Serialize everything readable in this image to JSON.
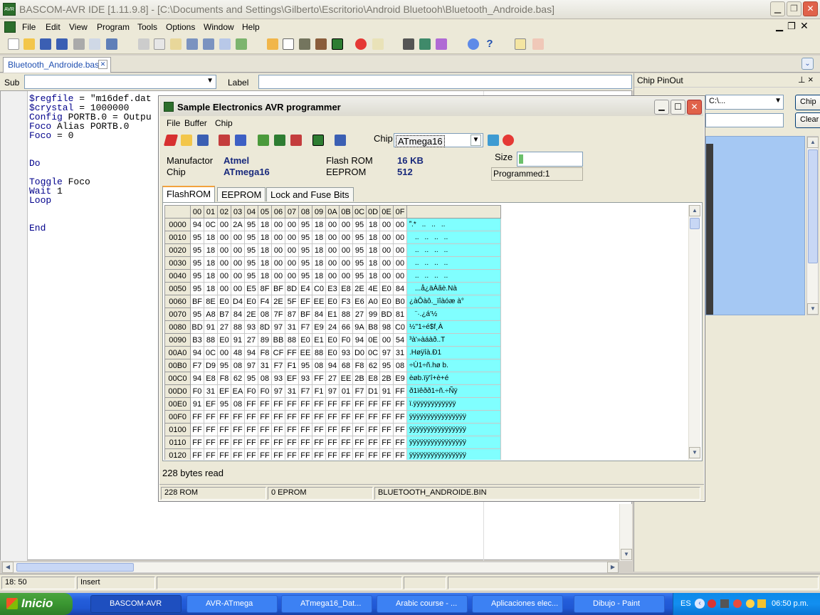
{
  "window": {
    "title": "BASCOM-AVR IDE [1.11.9.8] - [C:\\Documents and Settings\\Gilberto\\Escritorio\\Android Bluetooh\\Bluetooth_Androide.bas]",
    "icon_text": "AVR"
  },
  "menu": [
    "File",
    "Edit",
    "View",
    "Program",
    "Tools",
    "Options",
    "Window",
    "Help"
  ],
  "doc_tab": "Bluetooth_Androide.bas",
  "subbar": {
    "sub_label": "Sub",
    "label_label": "Label"
  },
  "code_lines": [
    {
      "kw": "$regfile",
      "rest": " = \"m16def.dat"
    },
    {
      "kw": "$crystal",
      "rest": " = 1000000"
    },
    {
      "kw": "Config",
      "rest": " PORTB.0 = Outpu"
    },
    {
      "kw": "Foco",
      "rest": " Alias PORTB.0"
    },
    {
      "kw": "Foco",
      "rest": " = 0"
    },
    {
      "kw": "",
      "rest": ""
    },
    {
      "kw": "",
      "rest": ""
    },
    {
      "kw": "Do",
      "rest": ""
    },
    {
      "kw": "",
      "rest": ""
    },
    {
      "kw": "Toggle",
      "rest": " Foco"
    },
    {
      "kw": "Wait",
      "rest": " 1"
    },
    {
      "kw": "Loop",
      "rest": ""
    },
    {
      "kw": "",
      "rest": ""
    },
    {
      "kw": "",
      "rest": ""
    },
    {
      "kw": "End",
      "rest": ""
    }
  ],
  "pinout": {
    "title": "Chip PinOut",
    "path": "C:\\...",
    "chip_button": "Chip",
    "clear_button": "Clear"
  },
  "programmer": {
    "title": "Sample Electronics AVR programmer",
    "menu": [
      "File",
      "Buffer",
      "Chip"
    ],
    "chip_label": "Chip",
    "chip_value": "ATmega16",
    "manufacturer_label": "Manufactor",
    "manufacturer": "Atmel",
    "chip_info_label": "Chip",
    "chip_info": "ATmega16",
    "flash_label": "Flash ROM",
    "flash": "16 KB",
    "eeprom_label": "EEPROM",
    "eeprom": "512",
    "size_label": "Size",
    "programmed": "Programmed:1",
    "tabs": [
      "FlashROM",
      "EEPROM",
      "Lock and Fuse Bits"
    ],
    "bytes_read": "228 bytes read",
    "status": [
      "228 ROM",
      "0 EPROM",
      "BLUETOOTH_ANDROIDE.BIN"
    ],
    "hex_header": [
      "00",
      "01",
      "02",
      "03",
      "04",
      "05",
      "06",
      "07",
      "08",
      "09",
      "0A",
      "0B",
      "0C",
      "0D",
      "0E",
      "0F"
    ],
    "hex_rows": [
      {
        "addr": "0000",
        "bytes": [
          "94",
          "0C",
          "00",
          "2A",
          "95",
          "18",
          "00",
          "00",
          "95",
          "18",
          "00",
          "00",
          "95",
          "18",
          "00",
          "00"
        ],
        "ascii": ".*......"
      },
      {
        "addr": "0010",
        "bytes": [
          "95",
          "18",
          "00",
          "00",
          "95",
          "18",
          "00",
          "00",
          "95",
          "18",
          "00",
          "00",
          "95",
          "18",
          "00",
          "00"
        ],
        "ascii": "........"
      },
      {
        "addr": "0020",
        "bytes": [
          "95",
          "18",
          "00",
          "00",
          "95",
          "18",
          "00",
          "00",
          "95",
          "18",
          "00",
          "00",
          "95",
          "18",
          "00",
          "00"
        ],
        "ascii": "........"
      },
      {
        "addr": "0030",
        "bytes": [
          "95",
          "18",
          "00",
          "00",
          "95",
          "18",
          "00",
          "00",
          "95",
          "18",
          "00",
          "00",
          "95",
          "18",
          "00",
          "00"
        ],
        "ascii": "........"
      },
      {
        "addr": "0040",
        "bytes": [
          "95",
          "18",
          "00",
          "00",
          "95",
          "18",
          "00",
          "00",
          "95",
          "18",
          "00",
          "00",
          "95",
          "18",
          "00",
          "00"
        ],
        "ascii": "........"
      },
      {
        "addr": "0050",
        "bytes": [
          "95",
          "18",
          "00",
          "00",
          "E5",
          "8F",
          "BF",
          "8D",
          "E4",
          "C0",
          "E3",
          "E8",
          "2E",
          "4E",
          "E0",
          "84"
        ],
        "ascii": "...å¿äÀãè.Nà"
      },
      {
        "addr": "0060",
        "bytes": [
          "BF",
          "8E",
          "E0",
          "D4",
          "E0",
          "F4",
          "2E",
          "5F",
          "EF",
          "EE",
          "E0",
          "F3",
          "E6",
          "A0",
          "E0",
          "B0"
        ],
        "ascii": "¿àÔàô._ïîàóæ à°"
      },
      {
        "addr": "0070",
        "bytes": [
          "95",
          "A8",
          "B7",
          "84",
          "2E",
          "08",
          "7F",
          "87",
          "BF",
          "84",
          "E1",
          "88",
          "27",
          "99",
          "BD",
          "81"
        ],
        "ascii": "¨·.¿á'½"
      },
      {
        "addr": "0080",
        "bytes": [
          "BD",
          "91",
          "27",
          "88",
          "93",
          "8D",
          "97",
          "31",
          "F7",
          "E9",
          "24",
          "66",
          "9A",
          "B8",
          "98",
          "C0"
        ],
        "ascii": "½''1÷é$f¸À"
      },
      {
        "addr": "0090",
        "bytes": [
          "B3",
          "88",
          "E0",
          "91",
          "27",
          "89",
          "BB",
          "88",
          "E0",
          "E1",
          "E0",
          "F0",
          "94",
          "0E",
          "00",
          "54"
        ],
        "ascii": "³à'»àáàð..T"
      },
      {
        "addr": "00A0",
        "bytes": [
          "94",
          "0C",
          "00",
          "48",
          "94",
          "F8",
          "CF",
          "FF",
          "EE",
          "88",
          "E0",
          "93",
          "D0",
          "0C",
          "97",
          "31"
        ],
        "ascii": ".Høÿîà.Ð1"
      },
      {
        "addr": "00B0",
        "bytes": [
          "F7",
          "D9",
          "95",
          "08",
          "97",
          "31",
          "F7",
          "F1",
          "95",
          "08",
          "94",
          "68",
          "F8",
          "62",
          "95",
          "08"
        ],
        "ascii": "÷Ù1÷ñ.hø b."
      },
      {
        "addr": "00C0",
        "bytes": [
          "94",
          "E8",
          "F8",
          "62",
          "95",
          "08",
          "93",
          "EF",
          "93",
          "FF",
          "27",
          "EE",
          "2B",
          "E8",
          "2B",
          "E9"
        ],
        "ascii": "èøb.ïÿ'î+è+é"
      },
      {
        "addr": "00D0",
        "bytes": [
          "F0",
          "31",
          "EF",
          "EA",
          "F0",
          "F0",
          "97",
          "31",
          "F7",
          "F1",
          "97",
          "01",
          "F7",
          "D1",
          "91",
          "FF"
        ],
        "ascii": "ð1ïêðð1÷ñ.÷Ñÿ"
      },
      {
        "addr": "00E0",
        "bytes": [
          "91",
          "EF",
          "95",
          "08",
          "FF",
          "FF",
          "FF",
          "FF",
          "FF",
          "FF",
          "FF",
          "FF",
          "FF",
          "FF",
          "FF",
          "FF"
        ],
        "ascii": "ï.ÿÿÿÿÿÿÿÿÿÿÿÿ"
      },
      {
        "addr": "00F0",
        "bytes": [
          "FF",
          "FF",
          "FF",
          "FF",
          "FF",
          "FF",
          "FF",
          "FF",
          "FF",
          "FF",
          "FF",
          "FF",
          "FF",
          "FF",
          "FF",
          "FF"
        ],
        "ascii": "ÿÿÿÿÿÿÿÿÿÿÿÿÿÿÿÿ"
      },
      {
        "addr": "0100",
        "bytes": [
          "FF",
          "FF",
          "FF",
          "FF",
          "FF",
          "FF",
          "FF",
          "FF",
          "FF",
          "FF",
          "FF",
          "FF",
          "FF",
          "FF",
          "FF",
          "FF"
        ],
        "ascii": "ÿÿÿÿÿÿÿÿÿÿÿÿÿÿÿÿ"
      },
      {
        "addr": "0110",
        "bytes": [
          "FF",
          "FF",
          "FF",
          "FF",
          "FF",
          "FF",
          "FF",
          "FF",
          "FF",
          "FF",
          "FF",
          "FF",
          "FF",
          "FF",
          "FF",
          "FF"
        ],
        "ascii": "ÿÿÿÿÿÿÿÿÿÿÿÿÿÿÿÿ"
      },
      {
        "addr": "0120",
        "bytes": [
          "FF",
          "FF",
          "FF",
          "FF",
          "FF",
          "FF",
          "FF",
          "FF",
          "FF",
          "FF",
          "FF",
          "FF",
          "FF",
          "FF",
          "FF",
          "FF"
        ],
        "ascii": "ÿÿÿÿÿÿÿÿÿÿÿÿÿÿÿÿ"
      }
    ]
  },
  "statusbar": {
    "position": "18: 50",
    "mode": "Insert"
  },
  "taskbar": {
    "start": "Inicio",
    "tasks": [
      "BASCOM-AVR",
      "AVR-ATmega",
      "ATmega16_Dat...",
      "Arabic course - ...",
      "Aplicaciones elec...",
      "Dibujo - Paint"
    ],
    "lang": "ES",
    "clock": "06:50 p.m."
  }
}
